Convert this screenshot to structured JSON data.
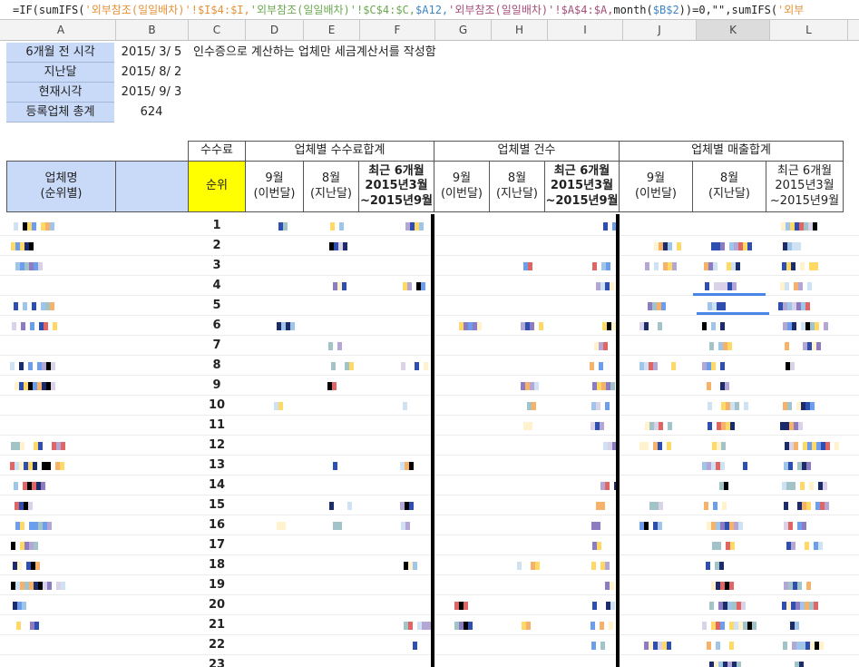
{
  "formula_bar": {
    "segments": [
      {
        "t": "=IF(sumIFS(",
        "c": ""
      },
      {
        "t": "'외부참조(일일배차)'",
        "c": "o"
      },
      {
        "t": "!$I$4:$I,",
        "c": "o"
      },
      {
        "t": "'외부참조(일일배차)'",
        "c": "g"
      },
      {
        "t": "!$C$4:$C,",
        "c": "g"
      },
      {
        "t": "$A12,",
        "c": "b"
      },
      {
        "t": "'외부참조(일일배차)'",
        "c": "p"
      },
      {
        "t": "!$A$4:$A,",
        "c": "p"
      },
      {
        "t": "month(",
        "c": ""
      },
      {
        "t": "$B$2",
        "c": "b"
      },
      {
        "t": "))=0,\"\",sumIFS(",
        "c": ""
      },
      {
        "t": "'외부",
        "c": "o"
      }
    ]
  },
  "columns": [
    "A",
    "B",
    "C",
    "D",
    "E",
    "F",
    "G",
    "H",
    "I",
    "J",
    "K",
    "L"
  ],
  "selected_column": "K",
  "info": {
    "rows": [
      {
        "label": "6개월 전 시각",
        "value": "2015/ 3/ 5"
      },
      {
        "label": "지난달",
        "value": "2015/ 8/ 2"
      },
      {
        "label": "현재시각",
        "value": "2015/ 9/ 3"
      },
      {
        "label": "등록업체 총계",
        "value": "624"
      }
    ],
    "note": "인수증으로 계산하는 업체만 세금계산서를 작성함"
  },
  "headers": {
    "fee": "수수료",
    "fee_total": "업체별 수수료합계",
    "count": "업체별 건수",
    "sales_total": "업체별 매출합계",
    "company_line1": "업체명",
    "company_line2": "(순위별)",
    "rank": "순위",
    "sep_line1": "9월",
    "sep_line2": "(이번달)",
    "aug_line1": "8월",
    "aug_line2": "(지난달)",
    "recent_bold_line1": "최근 6개월",
    "recent_bold_line2": "2015년3월",
    "recent_bold_line3": "~2015년9월",
    "recent_line1": "최근 6개월",
    "recent_line2": "2015년3월",
    "recent_line3": "~2015년9월"
  },
  "ranks": [
    "1",
    "2",
    "3",
    "4",
    "5",
    "6",
    "7",
    "8",
    "9",
    "10",
    "11",
    "12",
    "13",
    "14",
    "15",
    "16",
    "17",
    "18",
    "19",
    "20",
    "21",
    "22",
    "23"
  ],
  "colors": {
    "info_bg": "#c9daf8",
    "rank_header_bg": "#ffff00",
    "accent_line": "#4a86e8"
  }
}
